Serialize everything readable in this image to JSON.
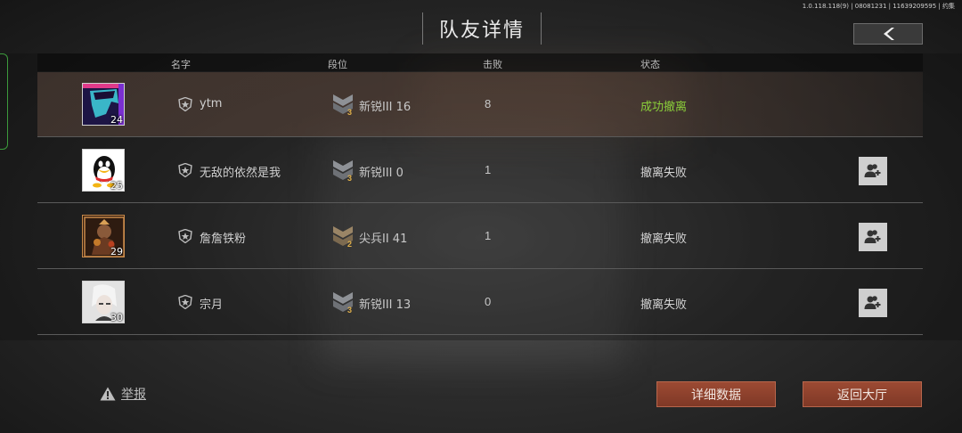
{
  "version": "1.0.118.118(9) | 08081231 | 11639209595 | 约集",
  "title": "队友详情",
  "columns": {
    "name": "名字",
    "rank": "段位",
    "kills": "击败",
    "status": "状态"
  },
  "players": [
    {
      "name": "ytm",
      "level": "24",
      "rank": "新锐III 16",
      "rank_tier": "3",
      "kills": "8",
      "status": "成功撤离",
      "status_success": true,
      "add_friend": false
    },
    {
      "name": "无敌的依然是我",
      "level": "25",
      "rank": "新锐III 0",
      "rank_tier": "3",
      "kills": "1",
      "status": "撤离失败",
      "status_success": false,
      "add_friend": true
    },
    {
      "name": "詹詹铁粉",
      "level": "29",
      "rank": "尖兵II 41",
      "rank_tier": "2",
      "kills": "1",
      "status": "撤离失败",
      "status_success": false,
      "add_friend": true
    },
    {
      "name": "宗月",
      "level": "30",
      "rank": "新锐III 13",
      "rank_tier": "3",
      "kills": "0",
      "status": "撤离失败",
      "status_success": false,
      "add_friend": true
    }
  ],
  "footer": {
    "report_label": "举报",
    "details_button": "详细数据",
    "lobby_button": "返回大厅"
  },
  "icons": {
    "back": "chevron-left-icon",
    "add_friend": "add-friend-icon",
    "badge": "star-shield-icon",
    "report": "warning-icon"
  },
  "colors": {
    "success": "#8bcf3a",
    "button": "#9c4a33",
    "rank_tier": "#e0b04a"
  }
}
